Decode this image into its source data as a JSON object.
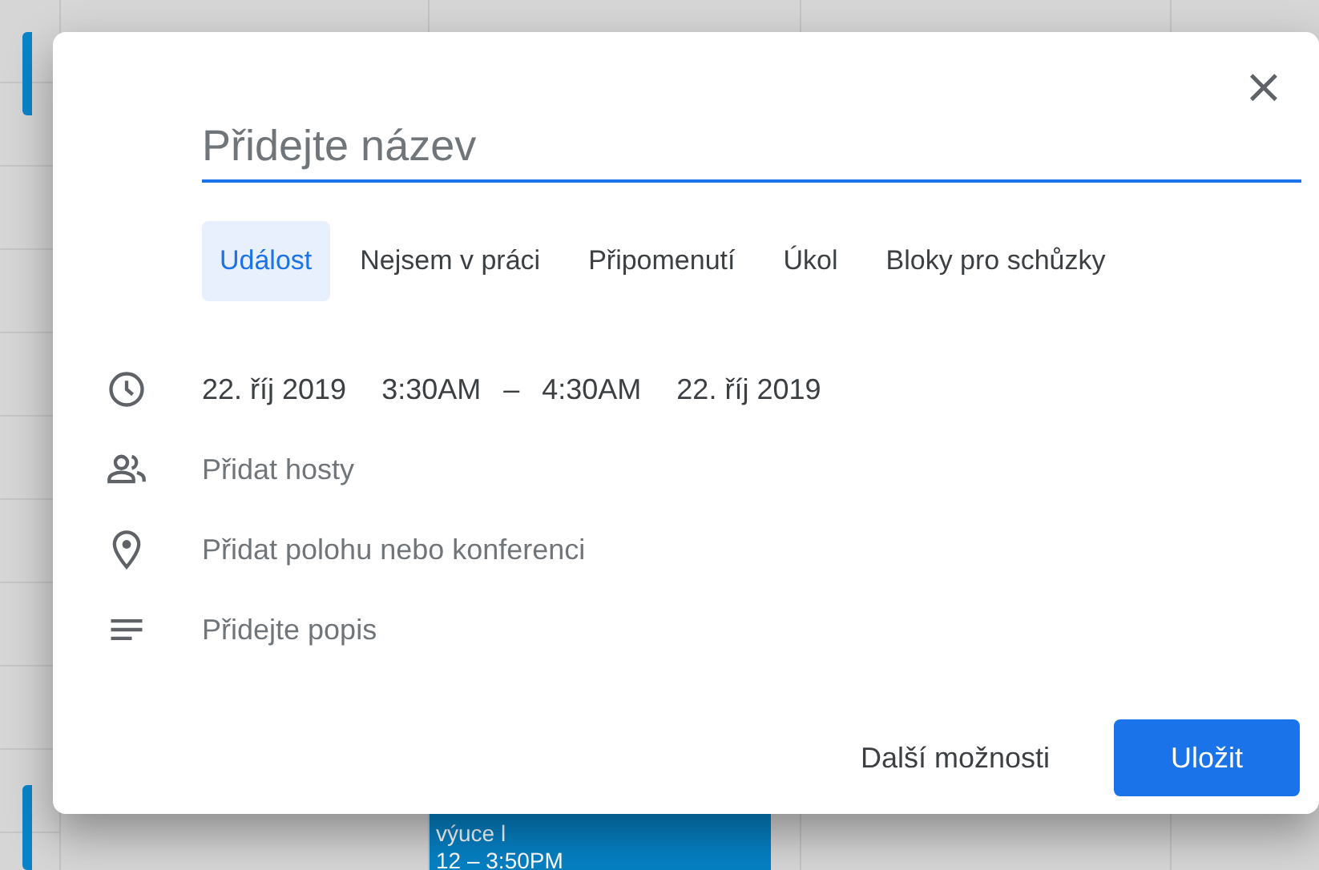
{
  "background_event": {
    "title": "výuce l",
    "time": "12 – 3:50PM"
  },
  "dialog": {
    "close": "×",
    "title": {
      "placeholder": "Přidejte název"
    },
    "tabs": [
      {
        "label": "Událost",
        "selected": true
      },
      {
        "label": "Nejsem v práci",
        "selected": false
      },
      {
        "label": "Připomenutí",
        "selected": false
      },
      {
        "label": "Úkol",
        "selected": false
      },
      {
        "label": "Bloky pro schůzky",
        "selected": false
      }
    ],
    "when": {
      "start_date": "22. říj 2019",
      "start_time": "3:30AM",
      "separator": "–",
      "end_time": "4:30AM",
      "end_date": "22. říj 2019"
    },
    "fields": [
      {
        "kind": "guests",
        "placeholder": "Přidat hosty"
      },
      {
        "kind": "location",
        "placeholder": "Přidat polohu nebo konferenci"
      },
      {
        "kind": "description",
        "placeholder": "Přidejte popis"
      }
    ],
    "buttons": {
      "more": "Další možnosti",
      "save": "Uložit"
    }
  }
}
